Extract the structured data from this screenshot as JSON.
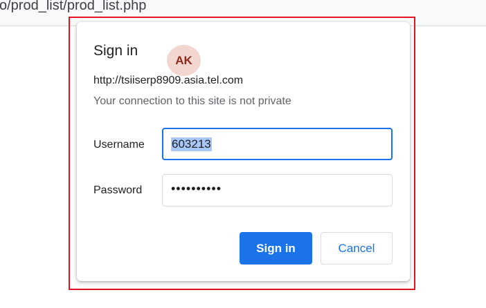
{
  "browser": {
    "url_fragment": "o/prod_list/prod_list.php"
  },
  "dialog": {
    "title": "Sign in",
    "avatar_initials": "AK",
    "host": "http://tsiiserp8909.asia.tel.com",
    "privacy_notice": "Your connection to this site is not private",
    "username_label": "Username",
    "username_value": "603213",
    "password_label": "Password",
    "password_masked": "••••••••••",
    "signin_label": "Sign in",
    "cancel_label": "Cancel"
  },
  "colors": {
    "accent": "#1a73e8",
    "highlight_frame": "#e0131f",
    "selection": "#a8c7fa",
    "avatar_bg": "#f3d6d0",
    "avatar_fg": "#8a2b1b"
  }
}
